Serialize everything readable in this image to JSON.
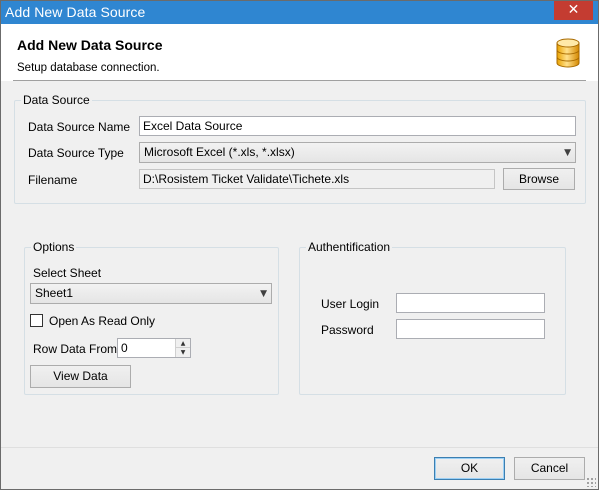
{
  "window": {
    "title": "Add New Data Source",
    "close_glyph": "✕",
    "accent_color": "#2f86d1",
    "close_color": "#c43c31"
  },
  "header": {
    "title": "Add New Data Source",
    "subtitle": "Setup database connection.",
    "icon": "database-icon"
  },
  "data_source": {
    "legend": "Data Source",
    "name_label": "Data Source Name",
    "name_value": "Excel Data Source",
    "type_label": "Data Source Type",
    "type_value": "Microsoft Excel (*.xls, *.xlsx)",
    "filename_label": "Filename",
    "filename_value": "D:\\Rosistem Ticket Validate\\Tichete.xls",
    "browse_label": "Browse"
  },
  "options": {
    "legend": "Options",
    "select_sheet_label": "Select Sheet",
    "sheet_value": "Sheet1",
    "read_only_label": "Open As Read Only",
    "read_only_checked": false,
    "row_from_label": "Row Data From",
    "row_from_value": "0",
    "view_data_label": "View Data"
  },
  "auth": {
    "legend": "Authentification",
    "login_label": "User Login",
    "login_value": "",
    "password_label": "Password",
    "password_value": ""
  },
  "footer": {
    "ok_label": "OK",
    "cancel_label": "Cancel"
  }
}
